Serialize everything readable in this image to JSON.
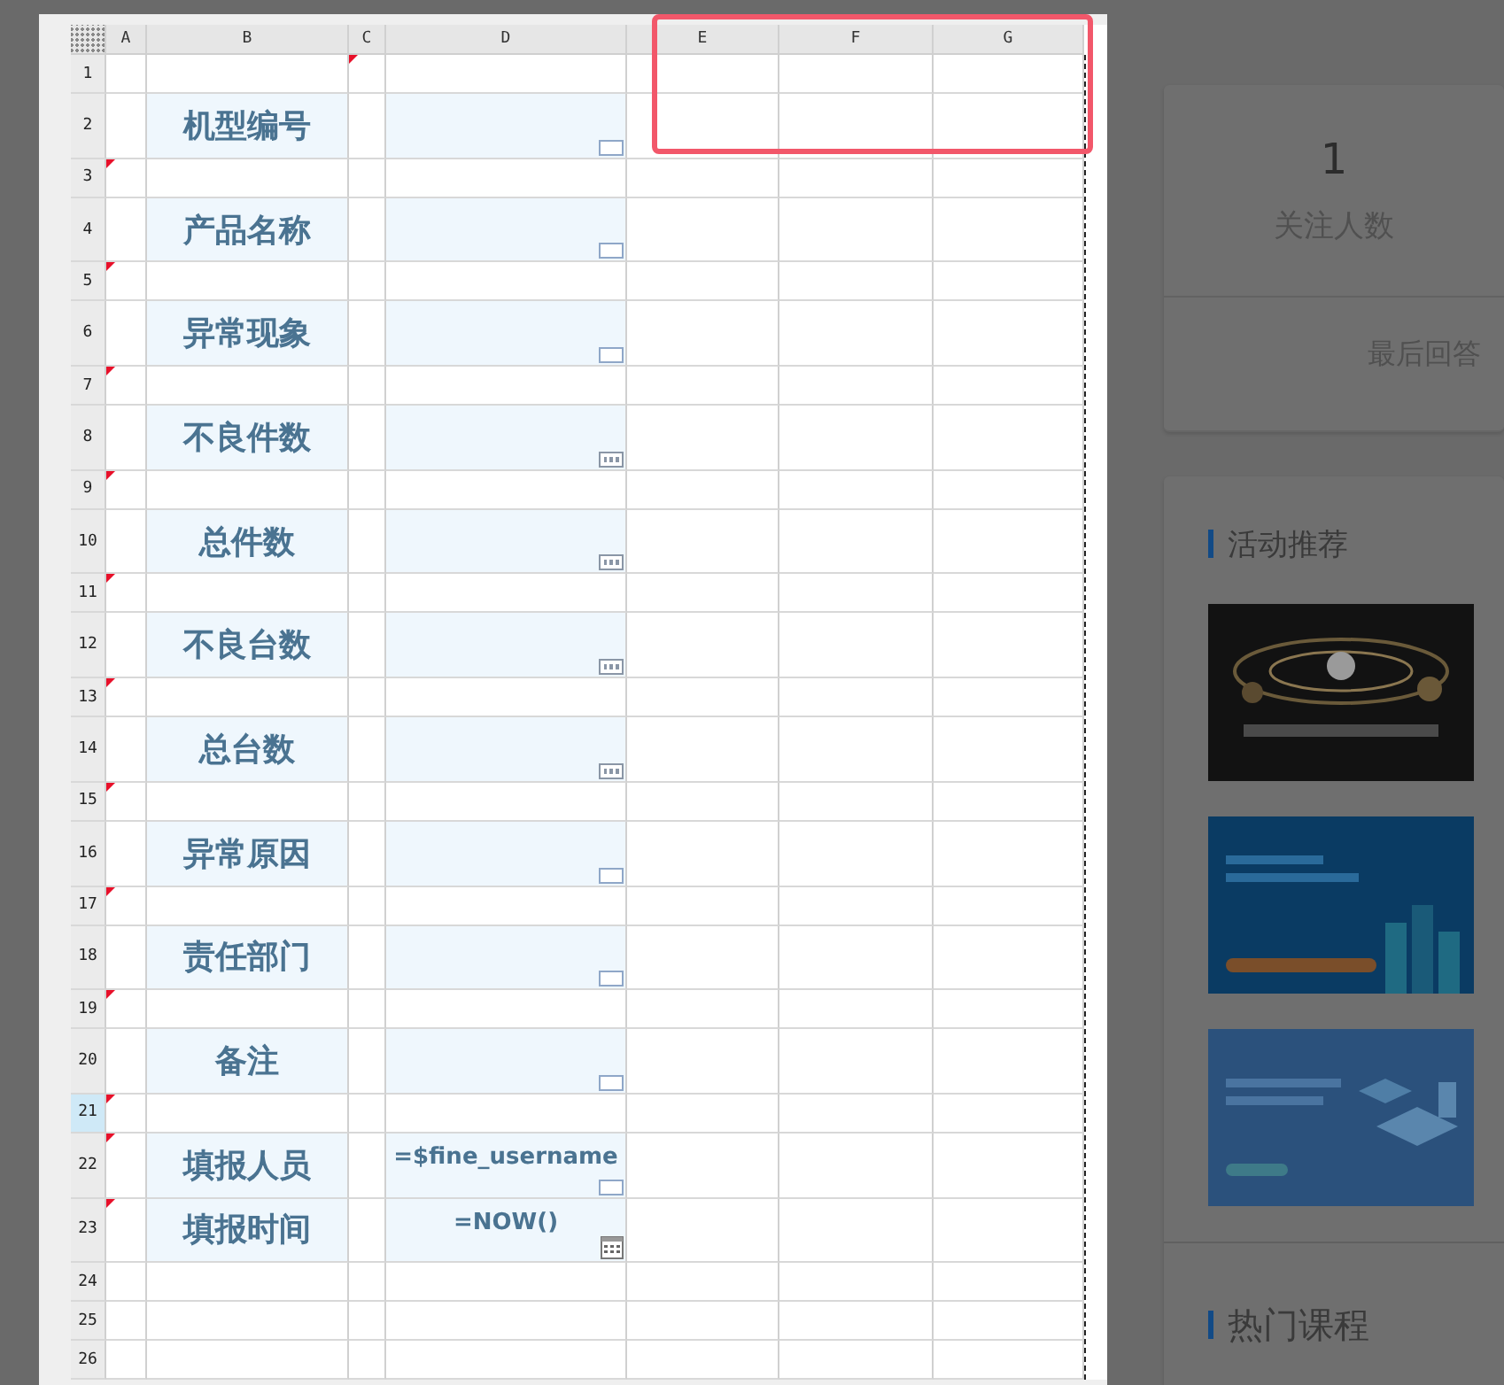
{
  "sheet": {
    "columns": [
      "A",
      "B",
      "C",
      "D",
      "E",
      "F",
      "G"
    ],
    "rows": [
      {
        "number": "1",
        "selected": false,
        "marked_a": false,
        "marked_c": true
      },
      {
        "number": "2",
        "selected": false,
        "marked_a": false,
        "marked_c": false,
        "label": "机型编号",
        "widget": {
          "kind": "text"
        }
      },
      {
        "number": "3",
        "selected": false,
        "marked_a": true,
        "marked_c": false
      },
      {
        "number": "4",
        "selected": false,
        "marked_a": false,
        "marked_c": false,
        "label": "产品名称",
        "widget": {
          "kind": "text"
        }
      },
      {
        "number": "5",
        "selected": false,
        "marked_a": true,
        "marked_c": false
      },
      {
        "number": "6",
        "selected": false,
        "marked_a": false,
        "marked_c": false,
        "label": "异常现象",
        "widget": {
          "kind": "text"
        }
      },
      {
        "number": "7",
        "selected": false,
        "marked_a": true,
        "marked_c": false
      },
      {
        "number": "8",
        "selected": false,
        "marked_a": false,
        "marked_c": false,
        "label": "不良件数",
        "widget": {
          "kind": "number"
        }
      },
      {
        "number": "9",
        "selected": false,
        "marked_a": true,
        "marked_c": false
      },
      {
        "number": "10",
        "selected": false,
        "marked_a": false,
        "marked_c": false,
        "label": "总件数",
        "widget": {
          "kind": "number"
        }
      },
      {
        "number": "11",
        "selected": false,
        "marked_a": true,
        "marked_c": false
      },
      {
        "number": "12",
        "selected": false,
        "marked_a": false,
        "marked_c": false,
        "label": "不良台数",
        "widget": {
          "kind": "number"
        }
      },
      {
        "number": "13",
        "selected": false,
        "marked_a": true,
        "marked_c": false
      },
      {
        "number": "14",
        "selected": false,
        "marked_a": false,
        "marked_c": false,
        "label": "总台数",
        "widget": {
          "kind": "number"
        }
      },
      {
        "number": "15",
        "selected": false,
        "marked_a": true,
        "marked_c": false
      },
      {
        "number": "16",
        "selected": false,
        "marked_a": false,
        "marked_c": false,
        "label": "异常原因",
        "widget": {
          "kind": "text"
        }
      },
      {
        "number": "17",
        "selected": false,
        "marked_a": true,
        "marked_c": false
      },
      {
        "number": "18",
        "selected": false,
        "marked_a": false,
        "marked_c": false,
        "label": "责任部门",
        "widget": {
          "kind": "text"
        }
      },
      {
        "number": "19",
        "selected": false,
        "marked_a": true,
        "marked_c": false
      },
      {
        "number": "20",
        "selected": false,
        "marked_a": false,
        "marked_c": false,
        "label": "备注",
        "widget": {
          "kind": "text"
        }
      },
      {
        "number": "21",
        "selected": true,
        "marked_a": true,
        "marked_c": false
      },
      {
        "number": "22",
        "selected": false,
        "marked_a": true,
        "marked_c": false,
        "label": "填报人员",
        "widget": {
          "kind": "text"
        },
        "value": "=$fine_username"
      },
      {
        "number": "23",
        "selected": false,
        "marked_a": true,
        "marked_c": false,
        "label": "填报时间",
        "widget": {
          "kind": "date"
        },
        "value": "=NOW()"
      },
      {
        "number": "24",
        "selected": false,
        "marked_a": false,
        "marked_c": false
      },
      {
        "number": "25",
        "selected": false,
        "marked_a": false,
        "marked_c": false
      },
      {
        "number": "26",
        "selected": false,
        "marked_a": false,
        "marked_c": false
      }
    ]
  },
  "sidebar": {
    "stats": {
      "count": "1",
      "label": "关注人数",
      "last_answer": "最后回答"
    },
    "promo": {
      "title": "活动推荐"
    },
    "courses": {
      "title": "热门课程"
    }
  }
}
